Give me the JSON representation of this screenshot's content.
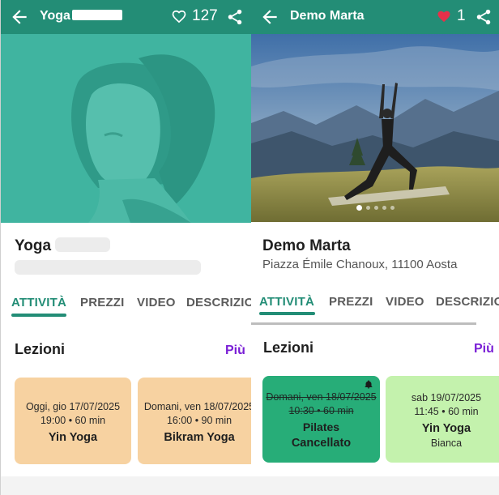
{
  "left": {
    "appbar": {
      "title": "Yoga",
      "likes": "127"
    },
    "info": {
      "title": "Yoga"
    },
    "tabs": [
      "ATTIVITÀ",
      "PREZZI",
      "VIDEO",
      "DESCRIZIO"
    ],
    "section": {
      "title": "Lezioni",
      "more": "Più"
    },
    "cards": [
      {
        "date": "Oggi, gio 17/07/2025",
        "time": "19:00 • 60 min",
        "name": "Yin Yoga"
      },
      {
        "date": "Domani, ven 18/07/2025",
        "time": "16:00 • 90 min",
        "name": "Bikram Yoga"
      }
    ]
  },
  "right": {
    "appbar": {
      "title": "Demo Marta",
      "likes": "1"
    },
    "info": {
      "title": "Demo Marta",
      "address": "Piazza Émile Chanoux, 11100 Aosta"
    },
    "tabs": [
      "ATTIVITÀ",
      "PREZZI",
      "VIDEO",
      "DESCRIZIO"
    ],
    "section": {
      "title": "Lezioni",
      "more": "Più"
    },
    "cards": [
      {
        "date": "Domani, ven 18/07/2025",
        "time": "10:30 • 60 min",
        "name": "Pilates",
        "status": "Cancellato"
      },
      {
        "date": "sab 19/07/2025",
        "time": "11:45 • 60 min",
        "name": "Yin Yoga",
        "sub": "Bianca"
      }
    ]
  },
  "colors": {
    "brand": "#238d76",
    "more_link": "#7a1fd6",
    "heart_filled": "#e5304a",
    "card_peach": "#f7d2a1",
    "card_cancelled": "#27ad78",
    "card_green": "#c4f2ad"
  },
  "icons": [
    "back-arrow-icon",
    "heart-outline-icon",
    "heart-filled-icon",
    "share-icon",
    "bell-icon"
  ]
}
